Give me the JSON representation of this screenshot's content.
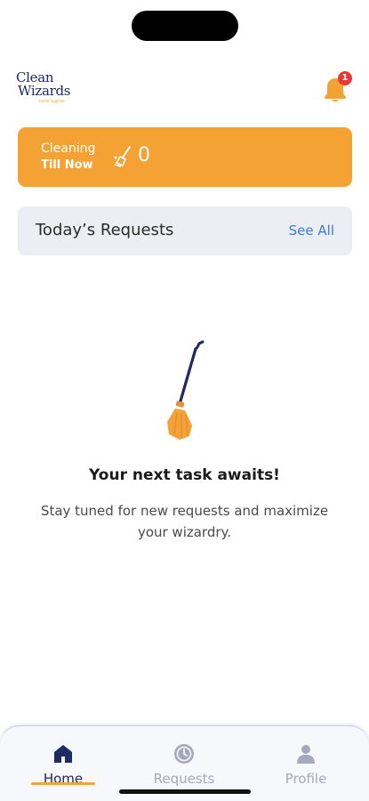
{
  "brand": {
    "line1": "Clean",
    "line2": "Wizards",
    "tagline": "home hygiene"
  },
  "notifications": {
    "badge_count": "1"
  },
  "stats": {
    "label_line1": "Cleaning",
    "label_line2": "Till Now",
    "count": "0"
  },
  "requests": {
    "title": "Today’s Requests",
    "see_all": "See All"
  },
  "empty_state": {
    "title": "Your next task awaits!",
    "text": "Stay tuned for new requests and maximize your wizardry."
  },
  "tabs": [
    {
      "label": "Home",
      "icon": "home-icon",
      "active": true
    },
    {
      "label": "Requests",
      "icon": "clock-icon",
      "active": false
    },
    {
      "label": "Profile",
      "icon": "person-icon",
      "active": false
    }
  ],
  "colors": {
    "accent": "#f4a233",
    "brand_navy": "#1e2a64",
    "link": "#3d7be0",
    "badge": "#e53935"
  }
}
